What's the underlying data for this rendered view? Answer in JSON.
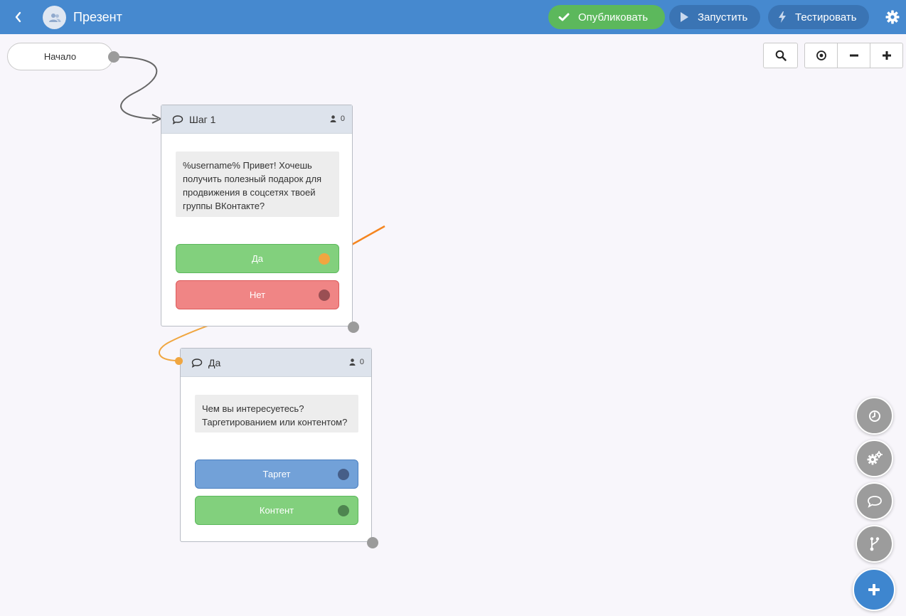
{
  "colors": {
    "topbar": "#4689cf",
    "publish": "#5cb85c",
    "action_pill": "#3a74b4",
    "node_gray": "#9b9b9b",
    "wire_dark": "#666666",
    "wire_orange": "#f0a640",
    "annotation_arrow": "#f5851f",
    "btn_green": "#82d07d",
    "btn_green_border": "#5cb85c",
    "btn_red": "#f08585",
    "btn_red_border": "#dd5b5b",
    "btn_blue": "#72a1d8",
    "btn_blue_border": "#4a7fc0",
    "dot_orange": "#f0a640",
    "dot_maroon": "#9a4f53",
    "dot_navy": "#465e88",
    "dot_green": "#4e8550",
    "fab_gray": "#9c9c9c",
    "fab_blue": "#3e86cf"
  },
  "header": {
    "title": "Презент",
    "back_icon": "chevron-left-icon",
    "avatar_icon": "people-icon",
    "settings_icon": "gear-icon",
    "actions": {
      "publish": {
        "label": "Опубликовать",
        "icon": "check-icon"
      },
      "run": {
        "label": "Запустить",
        "icon": "play-icon"
      },
      "test": {
        "label": "Тестировать",
        "icon": "lightning-icon"
      }
    }
  },
  "canvas": {
    "start_node": {
      "label": "Начало"
    },
    "zoom_controls": [
      "search-icon",
      "target-icon",
      "minus-icon",
      "plus-icon"
    ],
    "cards": [
      {
        "title": "Шаг 1",
        "icon": "speech-bubble-icon",
        "count": "0",
        "message": "%username% Привет! Хочешь получить полезный подарок для продвижения в соцсетях твоей группы ВКонтакте?",
        "buttons": [
          {
            "label": "Да",
            "style": "green"
          },
          {
            "label": "Нет",
            "style": "red"
          }
        ]
      },
      {
        "title": "Да",
        "icon": "speech-bubble-icon",
        "count": "0",
        "message": "Чем вы интересуетесь? Таргетированием или контентом?",
        "buttons": [
          {
            "label": "Таргет",
            "style": "blue"
          },
          {
            "label": "Контент",
            "style": "green"
          }
        ]
      }
    ]
  },
  "fab_stack": [
    "clock-icon",
    "gears-icon",
    "speech-bubble-icon",
    "branch-icon",
    "plus-icon"
  ]
}
